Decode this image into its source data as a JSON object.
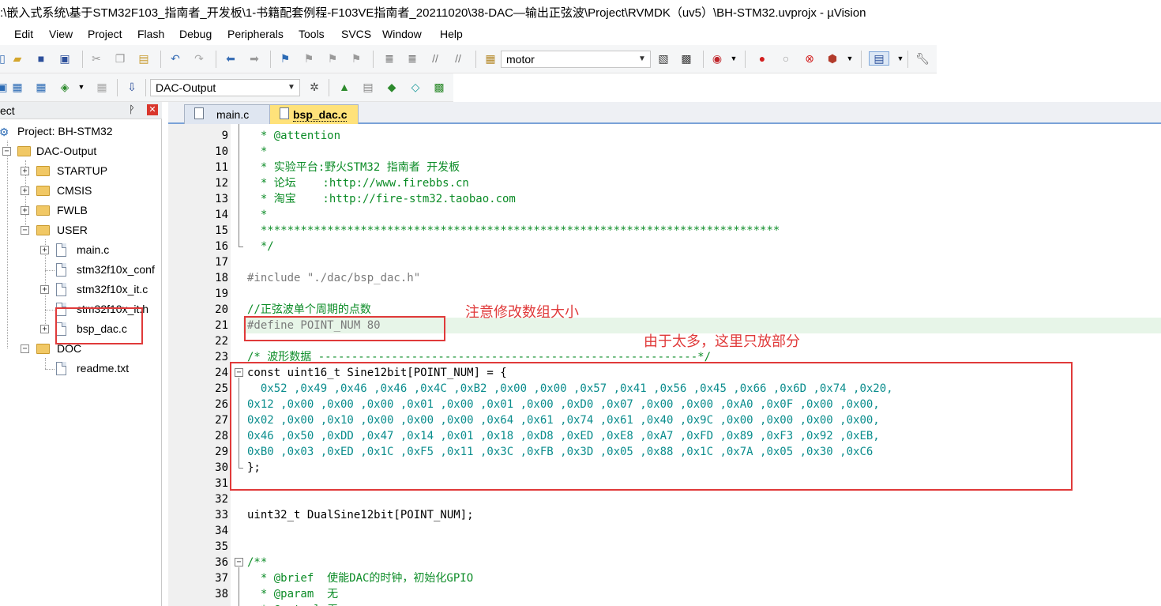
{
  "window": {
    "title": ":\\嵌入式系统\\基于STM32F103_指南者_开发板\\1-书籍配套例程-F103VE指南者_20211020\\38-DAC—输出正弦波\\Project\\RVMDK（uv5）\\BH-STM32.uvprojx - µVision"
  },
  "menu": [
    "Edit",
    "View",
    "Project",
    "Flash",
    "Debug",
    "Peripherals",
    "Tools",
    "SVCS",
    "Window",
    "Help"
  ],
  "toolbar1": {
    "find_combo_value": "motor"
  },
  "toolbar2": {
    "target_combo_value": "DAC-Output"
  },
  "project_panel": {
    "title": "ect",
    "pin_icon": "pin-icon",
    "close_icon": "close-icon",
    "tree": {
      "root": "Project: BH-STM32",
      "target": "DAC-Output",
      "groups": [
        {
          "name": "STARTUP",
          "expanded": false
        },
        {
          "name": "CMSIS",
          "expanded": false
        },
        {
          "name": "FWLB",
          "expanded": false
        },
        {
          "name": "USER",
          "expanded": true
        }
      ],
      "user_files": [
        "main.c",
        "stm32f10x_conf",
        "stm32f10x_it.c",
        "stm32f10x_it.h",
        "bsp_dac.c"
      ],
      "doc_group": "DOC",
      "doc_files": [
        "readme.txt"
      ]
    }
  },
  "tabs": [
    {
      "label": "main.c",
      "active": false
    },
    {
      "label": "bsp_dac.c",
      "active": true
    }
  ],
  "editor": {
    "line_numbers": [
      "9",
      "10",
      "11",
      "12",
      "13",
      "14",
      "15",
      "16",
      "17",
      "18",
      "19",
      "20",
      "21",
      "22",
      "23",
      "24",
      "25",
      "26",
      "27",
      "28",
      "29",
      "30",
      "31",
      "32",
      "33",
      "34",
      "35",
      "36",
      "37",
      "38"
    ],
    "lines": [
      "  * @attention",
      "  *",
      "  * 实验平台:野火STM32 指南者 开发板",
      "  * 论坛    :http://www.firebbs.cn",
      "  * 淘宝    :http://fire-stm32.taobao.com",
      "  *",
      "  ******************************************************************************",
      "  */",
      "",
      "#include \"./dac/bsp_dac.h\"",
      "",
      "//正弦波单个周期的点数",
      "#define POINT_NUM 80",
      "",
      "/* 波形数据 ---------------------------------------------------------*/",
      "const uint16_t Sine12bit[POINT_NUM] = {",
      "  0x52 ,0x49 ,0x46 ,0x46 ,0x4C ,0xB2 ,0x00 ,0x00 ,0x57 ,0x41 ,0x56 ,0x45 ,0x66 ,0x6D ,0x74 ,0x20,",
      "0x12 ,0x00 ,0x00 ,0x00 ,0x01 ,0x00 ,0x01 ,0x00 ,0xD0 ,0x07 ,0x00 ,0x00 ,0xA0 ,0x0F ,0x00 ,0x00,",
      "0x02 ,0x00 ,0x10 ,0x00 ,0x00 ,0x00 ,0x64 ,0x61 ,0x74 ,0x61 ,0x40 ,0x9C ,0x00 ,0x00 ,0x00 ,0x00,",
      "0x46 ,0x50 ,0xDD ,0x47 ,0x14 ,0x01 ,0x18 ,0xD8 ,0xED ,0xE8 ,0xA7 ,0xFD ,0x89 ,0xF3 ,0x92 ,0xEB,",
      "0xB0 ,0x03 ,0xED ,0x1C ,0xF5 ,0x11 ,0x3C ,0xFB ,0x3D ,0x05 ,0x88 ,0x1C ,0x7A ,0x05 ,0x30 ,0xC6",
      "};",
      "",
      "",
      "uint32_t DualSine12bit[POINT_NUM];",
      "",
      "",
      "/**",
      "  * @brief  使能DAC的时钟，初始化GPIO",
      "  * @param  无"
    ],
    "last_partial_line": "  * @retval 无",
    "highlighted_line_index": 12
  },
  "annotations": {
    "note_array_size": "注意修改数组大小",
    "note_partial": "由于太多，这里只放部分"
  },
  "colors": {
    "comment": "#0c8c27",
    "preprocessor": "#7a7a7a",
    "keyword": "#1f3bd8",
    "number": "#0b8d8d",
    "annotation_red": "#e03a3a",
    "active_tab": "#ffe27a"
  }
}
